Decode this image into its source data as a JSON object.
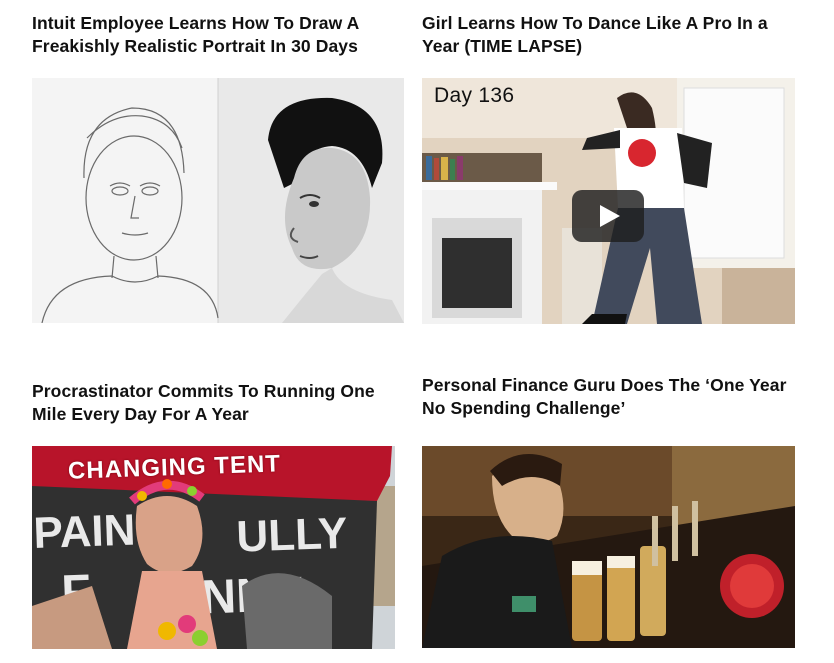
{
  "articles": [
    {
      "title": "Intuit Employee Learns How To Draw A Freakishly Realistic Portrait In 30 Days",
      "thumbnail": {
        "kind": "image"
      }
    },
    {
      "title": "Girl Learns How To Dance Like A Pro In a Year (TIME LAPSE)",
      "thumbnail": {
        "kind": "video",
        "overlay_text": "Day 136",
        "icon": "play-icon"
      }
    },
    {
      "title": "Procrastinator Commits To Running One Mile Every Day For A Year",
      "thumbnail": {
        "kind": "image",
        "banner_text": "CHANGING TENT"
      }
    },
    {
      "title": "Personal Finance Guru Does The ‘One Year No Spending Challenge’",
      "thumbnail": {
        "kind": "image"
      }
    }
  ],
  "colors": {
    "title_text": "#111111",
    "background": "#ffffff",
    "tent_red": "#b8142a",
    "play_button": "#1e1e1e"
  }
}
